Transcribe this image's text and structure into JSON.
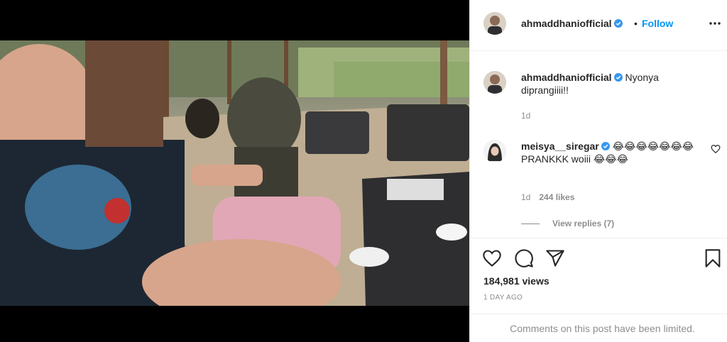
{
  "post": {
    "author": "ahmaddhaniofficial",
    "follow_separator": "•",
    "follow_label": "Follow",
    "more_icon": "more-dots-icon"
  },
  "comments": [
    {
      "username": "ahmaddhaniofficial",
      "verified": true,
      "text": "Nyonya diprangiiii!!",
      "time": "1d"
    },
    {
      "username": "meisya__siregar",
      "verified": true,
      "text": "😂😂😂😂😂😂😂 PRANKKK woiii 😂😂😂",
      "time": "1d",
      "likes": "244 likes",
      "view_replies": "View replies (7)"
    }
  ],
  "actions": {
    "like_icon": "heart-icon",
    "comment_icon": "comment-icon",
    "share_icon": "share-icon",
    "save_icon": "bookmark-icon"
  },
  "stats": {
    "views": "184,981 views",
    "time_ago": "1 DAY AGO"
  },
  "footer": {
    "limited_text": "Comments on this post have been limited."
  },
  "colors": {
    "accent": "#0095f6",
    "verified": "#3897f0",
    "muted": "#8e8e8e",
    "text": "#262626"
  }
}
